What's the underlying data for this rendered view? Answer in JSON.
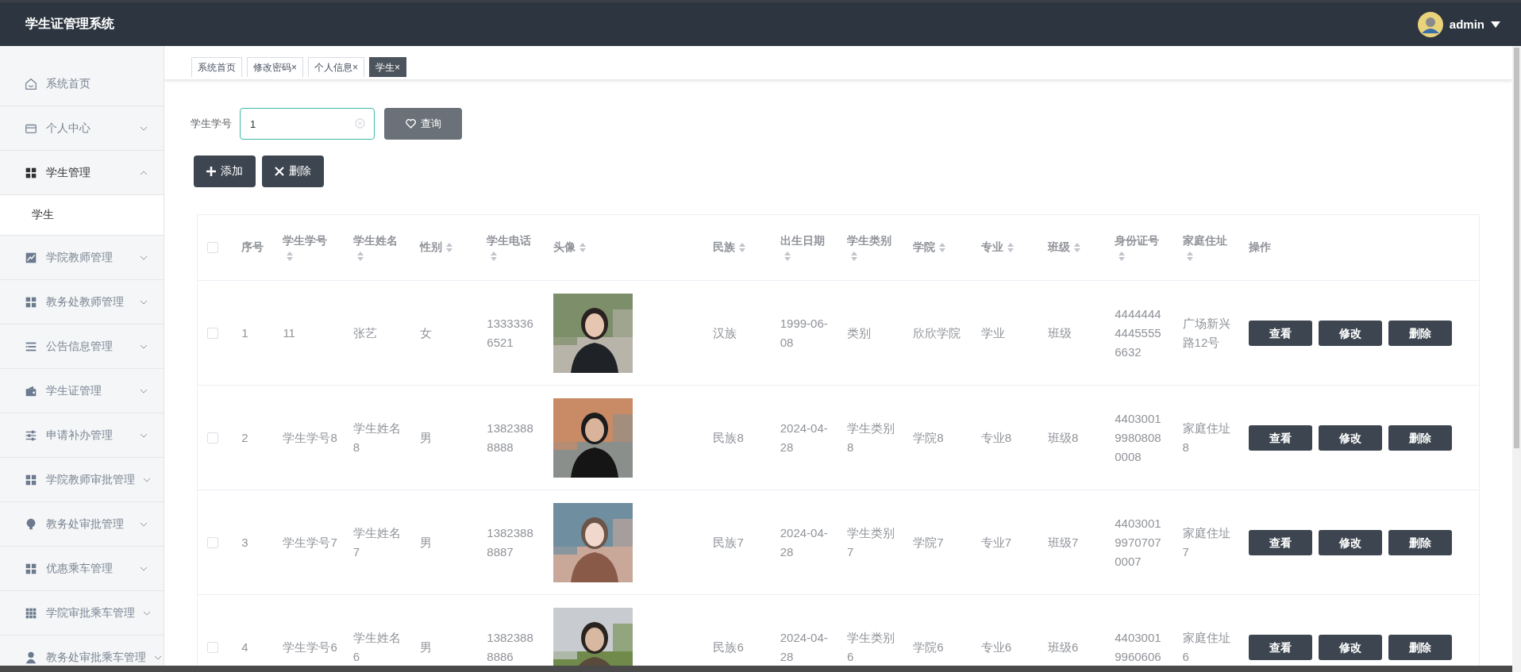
{
  "header": {
    "title": "学生证管理系统",
    "user": "admin"
  },
  "sidebar": {
    "items": [
      {
        "label": "系统首页",
        "kind": "link"
      },
      {
        "label": "个人中心",
        "kind": "menu",
        "expanded": false
      },
      {
        "label": "学生管理",
        "kind": "menu",
        "expanded": true,
        "children": [
          {
            "label": "学生",
            "selected": true
          }
        ]
      },
      {
        "label": "学院教师管理",
        "kind": "menu",
        "expanded": false
      },
      {
        "label": "教务处教师管理",
        "kind": "menu",
        "expanded": false
      },
      {
        "label": "公告信息管理",
        "kind": "menu",
        "expanded": false
      },
      {
        "label": "学生证管理",
        "kind": "menu",
        "expanded": false
      },
      {
        "label": "申请补办管理",
        "kind": "menu",
        "expanded": false
      },
      {
        "label": "学院教师审批管理",
        "kind": "menu",
        "expanded": false
      },
      {
        "label": "教务处审批管理",
        "kind": "menu",
        "expanded": false
      },
      {
        "label": "优惠乘车管理",
        "kind": "menu",
        "expanded": false
      },
      {
        "label": "学院审批乘车管理",
        "kind": "menu",
        "expanded": false
      },
      {
        "label": "教务处审批乘车管理",
        "kind": "menu",
        "expanded": false
      }
    ]
  },
  "tabs": [
    {
      "label": "系统首页",
      "selected": false
    },
    {
      "label": "修改密码",
      "close": "×",
      "selected": false
    },
    {
      "label": "个人信息",
      "close": "×",
      "selected": false
    },
    {
      "label": "学生",
      "close": "×",
      "selected": true
    }
  ],
  "search": {
    "label": "学生学号",
    "value": "1",
    "button": "查询"
  },
  "actions": [
    "添加",
    "删除"
  ],
  "table": {
    "header_checked": false,
    "columns": [
      {
        "label": "序号",
        "sortable": false
      },
      {
        "label": "学生学号",
        "sortable": true
      },
      {
        "label": "学生姓名",
        "sortable": true
      },
      {
        "label": "性别",
        "sortable": true
      },
      {
        "label": "学生电话",
        "sortable": true
      },
      {
        "label": "头像",
        "sortable": true
      },
      {
        "label": "民族",
        "sortable": true
      },
      {
        "label": "出生日期",
        "sortable": true
      },
      {
        "label": "学生类别",
        "sortable": true
      },
      {
        "label": "学院",
        "sortable": true
      },
      {
        "label": "专业",
        "sortable": true
      },
      {
        "label": "班级",
        "sortable": true
      },
      {
        "label": "身份证号",
        "sortable": true
      },
      {
        "label": "家庭住址",
        "sortable": true
      },
      {
        "label": "操作",
        "sortable": false
      }
    ],
    "rows": [
      {
        "checked": false,
        "cells": [
          "1",
          "11",
          "张艺",
          "女",
          "13333366521",
          "",
          "汉族",
          "1999-06-08",
          "类别",
          "欣欣学院",
          "学业",
          "班级",
          "444444444455556632",
          "广场新兴路12号"
        ],
        "avatar": {
          "kind": "picture"
        },
        "buttons": [
          "查看",
          "修改",
          "删除"
        ]
      },
      {
        "checked": false,
        "cells": [
          "2",
          "学生学号8",
          "学生姓名8",
          "男",
          "13823888888",
          "",
          "民族8",
          "2024-04-28",
          "学生类别8",
          "学院8",
          "专业8",
          "班级8",
          "440300199808080008",
          "家庭住址8"
        ],
        "avatar": {
          "kind": "picture"
        },
        "buttons": [
          "查看",
          "修改",
          "删除"
        ]
      },
      {
        "checked": false,
        "cells": [
          "3",
          "学生学号7",
          "学生姓名7",
          "男",
          "13823888887",
          "",
          "民族7",
          "2024-04-28",
          "学生类别7",
          "学院7",
          "专业7",
          "班级7",
          "440300199707070007",
          "家庭住址7"
        ],
        "avatar": {
          "kind": "picture"
        },
        "buttons": [
          "查看",
          "修改",
          "删除"
        ]
      },
      {
        "checked": false,
        "cells": [
          "4",
          "学生学号6",
          "学生姓名6",
          "男",
          "13823888886",
          "",
          "民族6",
          "2024-04-28",
          "学生类别6",
          "学院6",
          "专业6",
          "班级6",
          "44030019960606",
          "家庭住址6"
        ],
        "avatar": {
          "kind": "picture"
        },
        "buttons": [
          "查看",
          "修改",
          "删除"
        ]
      }
    ]
  }
}
